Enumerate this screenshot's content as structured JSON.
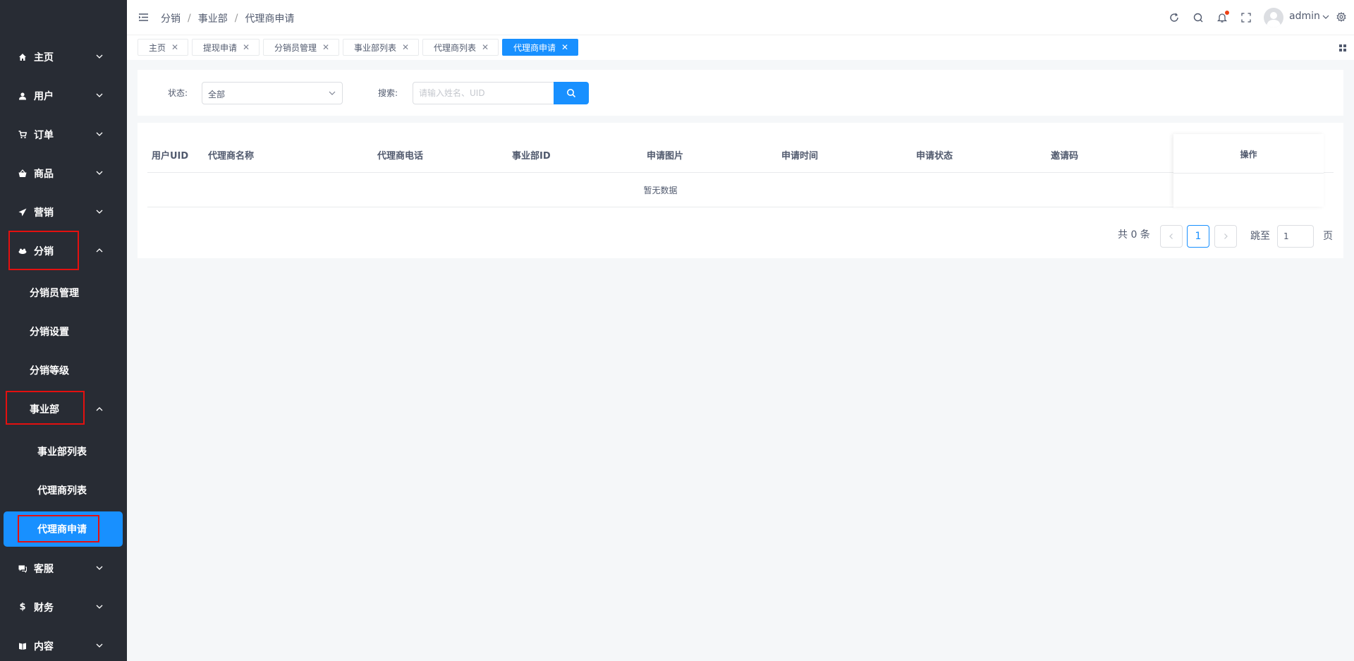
{
  "sidebar": {
    "menus": [
      {
        "label": "主页",
        "icon": "home-icon"
      },
      {
        "label": "用户",
        "icon": "user-icon"
      },
      {
        "label": "订单",
        "icon": "cart-icon"
      },
      {
        "label": "商品",
        "icon": "basket-icon"
      },
      {
        "label": "营销",
        "icon": "send-icon"
      },
      {
        "label": "分销",
        "icon": "distribution-icon"
      },
      {
        "label": "客服",
        "icon": "chat-icon"
      },
      {
        "label": "财务",
        "icon": "dollar-icon"
      },
      {
        "label": "内容",
        "icon": "book-icon"
      }
    ],
    "distribution_sub": [
      "分销员管理",
      "分销设置",
      "分销等级"
    ],
    "division_label": "事业部",
    "division_sub": [
      "事业部列表",
      "代理商列表",
      "代理商申请"
    ]
  },
  "header": {
    "breadcrumb": [
      "分销",
      "事业部",
      "代理商申请"
    ],
    "username": "admin"
  },
  "tabs": [
    {
      "label": "主页"
    },
    {
      "label": "提现申请"
    },
    {
      "label": "分销员管理"
    },
    {
      "label": "事业部列表"
    },
    {
      "label": "代理商列表"
    },
    {
      "label": "代理商申请",
      "active": true
    }
  ],
  "filter": {
    "status_label": "状态:",
    "status_value": "全部",
    "search_label": "搜索:",
    "search_placeholder": "请输入姓名、UID"
  },
  "table": {
    "columns": [
      "用户UID",
      "代理商名称",
      "代理商电话",
      "事业部ID",
      "申请图片",
      "申请时间",
      "申请状态",
      "邀请码"
    ],
    "action_column": "操作",
    "empty_text": "暂无数据"
  },
  "pagination": {
    "total_text": "共 0 条",
    "current_page": "1",
    "jump_label": "跳至",
    "jump_value": "1",
    "page_suffix": "页"
  },
  "colors": {
    "sidebar_bg": "#282c34",
    "accent": "#1890ff",
    "highlight_box": "#e4100f"
  }
}
